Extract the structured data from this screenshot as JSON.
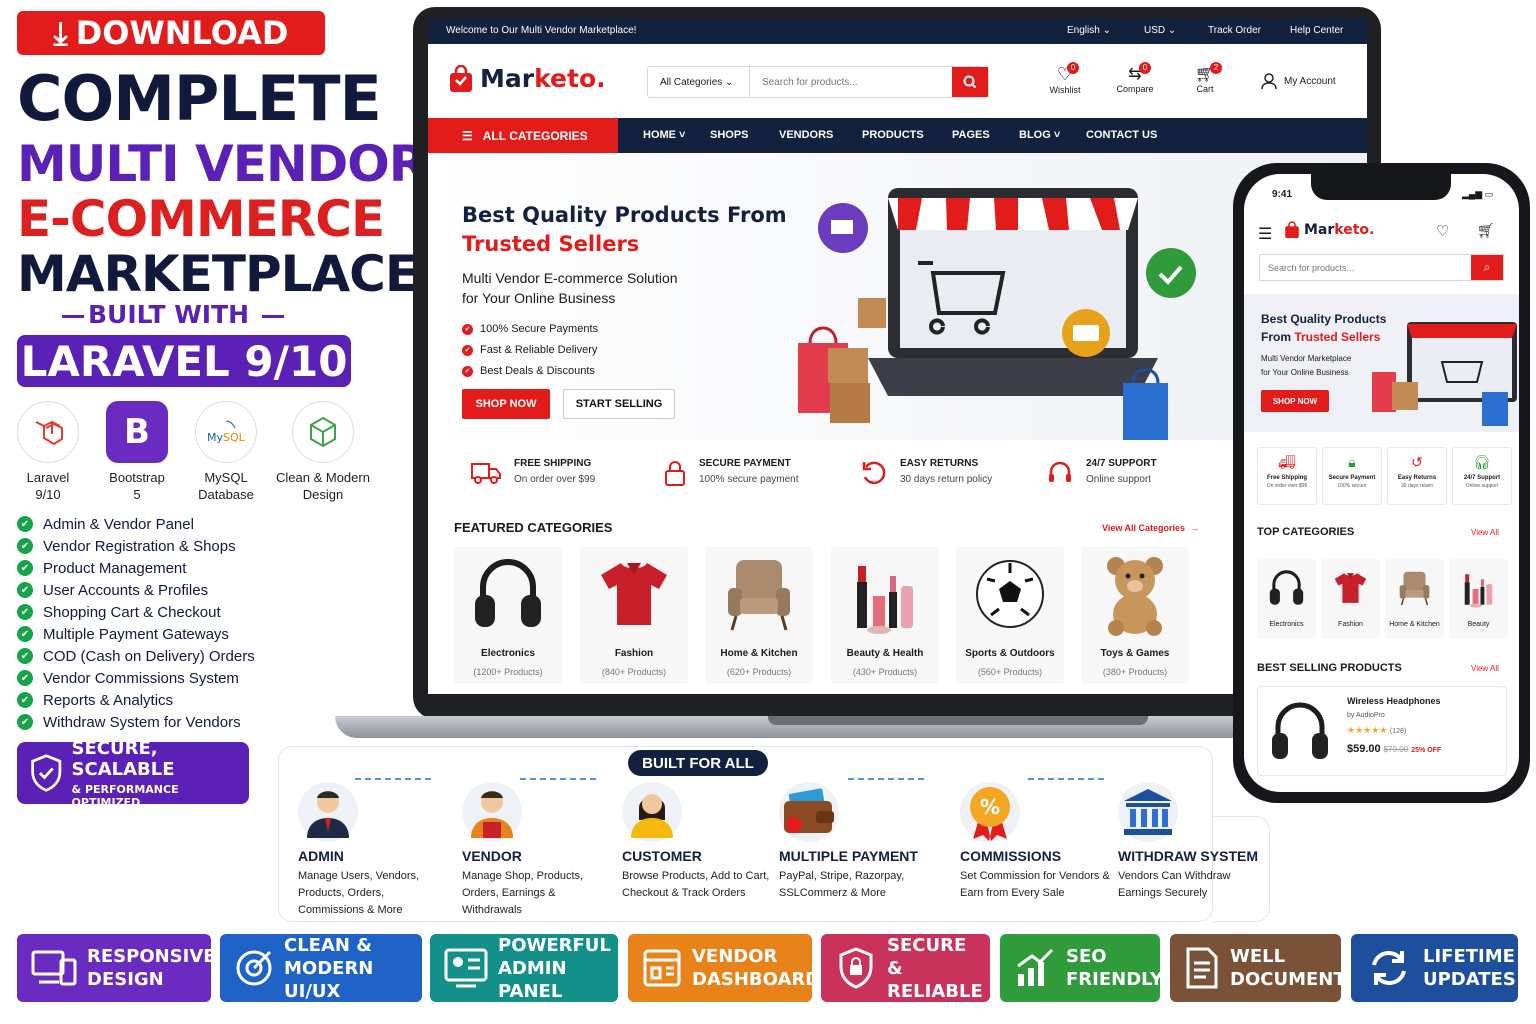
{
  "left": {
    "download": "DOWNLOAD",
    "h1": "COMPLETE",
    "h2": "MULTI VENDOR",
    "h3": "E-COMMERCE",
    "h4": "MARKETPLACE",
    "built_with": "BUILT WITH",
    "laravel": "LARAVEL 9/10",
    "tech": [
      {
        "a": "Laravel",
        "b": "9/10"
      },
      {
        "a": "Bootstrap",
        "b": "5"
      },
      {
        "a": "MySQL",
        "b": "Database"
      },
      {
        "a": "Clean & Modern",
        "b": "Design"
      }
    ],
    "features": [
      "Admin & Vendor Panel",
      "Vendor Registration & Shops",
      "Product Management",
      "User Accounts & Profiles",
      "Shopping Cart & Checkout",
      "Multiple Payment Gateways",
      "COD (Cash on Delivery) Orders",
      "Vendor Commissions System",
      "Reports & Analytics",
      "Withdraw System for Vendors"
    ],
    "secure_a": "SECURE, SCALABLE",
    "secure_b": "& PERFORMANCE OPTIMIZED"
  },
  "site": {
    "welcome": "Welcome to Our Multi Vendor Marketplace!",
    "lang": "English",
    "currency": "USD",
    "track": "Track Order",
    "help": "Help Center",
    "logo_a": "Mar",
    "logo_b": "keto.",
    "cat_select": "All Categories",
    "search_ph": "Search for products...",
    "wishlist": "Wishlist",
    "compare": "Compare",
    "cart": "Cart",
    "account": "My Account",
    "wish_count": "0",
    "compare_count": "0",
    "cart_count": "2",
    "all_categories": "ALL CATEGORIES",
    "nav": [
      "HOME",
      "SHOPS",
      "VENDORS",
      "PRODUCTS",
      "PAGES",
      "BLOG",
      "CONTACT US"
    ],
    "hero_t1": "Best Quality Products From",
    "hero_t2": "Trusted Sellers",
    "hero_s1": "Multi Vendor E-commerce Solution",
    "hero_s2": "for Your Online Business",
    "hero_points": [
      "100% Secure Payments",
      "Fast & Reliable Delivery",
      "Best Deals & Discounts"
    ],
    "shop_now": "SHOP NOW",
    "start_selling": "START SELLING",
    "services": [
      {
        "t": "FREE SHIPPING",
        "s": "On order over $99"
      },
      {
        "t": "SECURE PAYMENT",
        "s": "100% secure payment"
      },
      {
        "t": "EASY RETURNS",
        "s": "30 days return policy"
      },
      {
        "t": "24/7 SUPPORT",
        "s": "Online support"
      }
    ],
    "featured": "FEATURED CATEGORIES",
    "view_all": "View All Categories",
    "cats": [
      {
        "n": "Electronics",
        "c": "(1200+ Products)"
      },
      {
        "n": "Fashion",
        "c": "(840+ Products)"
      },
      {
        "n": "Home & Kitchen",
        "c": "(620+ Products)"
      },
      {
        "n": "Beauty & Health",
        "c": "(430+ Products)"
      },
      {
        "n": "Sports & Outdoors",
        "c": "(560+ Products)"
      },
      {
        "n": "Toys & Games",
        "c": "(380+ Products)"
      }
    ]
  },
  "phone": {
    "time": "9:41",
    "search_ph": "Search for products...",
    "hero_a": "Best Quality Products",
    "hero_b": "From ",
    "hero_c": "Trusted Sellers",
    "hero_s1": "Multi Vendor Marketplace",
    "hero_s2": "for Your Online Business",
    "shop_now": "SHOP NOW",
    "svc": [
      {
        "t": "Free Shipping",
        "s": "On order over $99"
      },
      {
        "t": "Secure Payment",
        "s": "100% secure"
      },
      {
        "t": "Easy Returns",
        "s": "30 days return"
      },
      {
        "t": "24/7 Support",
        "s": "Online support"
      }
    ],
    "top_cat": "TOP CATEGORIES",
    "view_all": "View All",
    "cats": [
      "Electronics",
      "Fashion",
      "Home & Kitchen",
      "Beauty"
    ],
    "best": "BEST SELLING PRODUCTS",
    "view_all2": "View All",
    "product": "Wireless Headphones",
    "by": "by AudioPro",
    "reviews": "(128)",
    "price": "$59.00",
    "old": "$79.00",
    "off": "25% OFF",
    "rating": 4.5
  },
  "bfa": {
    "title": "BUILT FOR ALL",
    "roles": [
      {
        "h": "ADMIN",
        "p": "Manage Users, Vendors, Products, Orders, Commissions & More"
      },
      {
        "h": "VENDOR",
        "p": "Manage Shop, Products, Orders, Earnings & Withdrawals"
      },
      {
        "h": "CUSTOMER",
        "p": "Browse Products, Add to Cart, Checkout & Track Orders"
      },
      {
        "h": "MULTIPLE PAYMENT",
        "p": "PayPal, Stripe, Razorpay, SSLCommerz & More"
      },
      {
        "h": "COMMISSIONS",
        "p": "Set Commission for Vendors & Earn from Every Sale"
      },
      {
        "h": "WITHDRAW SYSTEM",
        "p": "Vendors Can Withdraw Earnings Securely"
      }
    ]
  },
  "badges": [
    {
      "a": "RESPONSIVE",
      "b": "DESIGN",
      "color": "#6a2cc0"
    },
    {
      "a": "CLEAN & MODERN",
      "b": "UI/UX",
      "color": "#1f63c6"
    },
    {
      "a": "POWERFUL",
      "b": "ADMIN PANEL",
      "color": "#13908a"
    },
    {
      "a": "VENDOR",
      "b": "DASHBOARD",
      "color": "#e8821a"
    },
    {
      "a": "SECURE",
      "b": "& RELIABLE",
      "color": "#c9325a"
    },
    {
      "a": "SEO",
      "b": "FRIENDLY",
      "color": "#2f9b3a"
    },
    {
      "a": "WELL",
      "b": "DOCUMENTED",
      "color": "#7a5238"
    },
    {
      "a": "LIFETIME",
      "b": "UPDATES",
      "color": "#1d4f9c"
    }
  ]
}
